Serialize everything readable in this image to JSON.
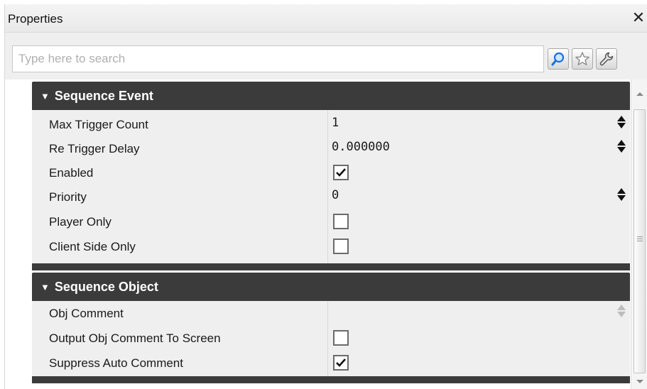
{
  "window": {
    "title": "Properties",
    "close_glyph": "✕"
  },
  "search": {
    "placeholder": "Type here to search",
    "value": ""
  },
  "toolbar": {
    "find_icon": "magnifier-icon",
    "favorites_icon": "star-icon",
    "options_icon": "wrench-icon"
  },
  "sections": [
    {
      "title": "Sequence Event",
      "properties": [
        {
          "label": "Max Trigger Count",
          "value": "1",
          "type": "spinner"
        },
        {
          "label": "Re Trigger Delay",
          "value": "0.000000",
          "type": "spinner"
        },
        {
          "label": "Enabled",
          "checked": true,
          "type": "checkbox"
        },
        {
          "label": "Priority",
          "value": "0",
          "type": "spinner"
        },
        {
          "label": "Player Only",
          "checked": false,
          "type": "checkbox"
        },
        {
          "label": "Client Side Only",
          "checked": false,
          "type": "checkbox"
        }
      ]
    },
    {
      "title": "Sequence Object",
      "properties": [
        {
          "label": "Obj Comment",
          "value": "",
          "type": "text"
        },
        {
          "label": "Output Obj Comment To Screen",
          "checked": false,
          "type": "checkbox"
        },
        {
          "label": "Suppress Auto Comment",
          "checked": true,
          "type": "checkbox"
        }
      ]
    }
  ],
  "colors": {
    "section_header_bg": "#3b3b3b",
    "panel_bg": "#efefef",
    "find_icon_accent": "#1e6fd9"
  }
}
